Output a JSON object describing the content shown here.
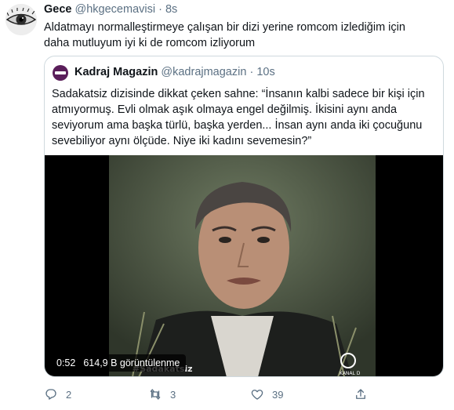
{
  "tweet": {
    "author_name": "Gece",
    "author_handle": "@hkgecemavisi",
    "separator": "·",
    "time": "8s",
    "text_line1": "Aldatmayı normalleştirmeye çalışan bir dizi yerine romcom izlediğim için",
    "text_line2": "daha mutluyum iyi ki de romcom izliyorum"
  },
  "quote": {
    "author_name": "Kadraj Magazin",
    "author_handle": "@kadrajmagazin",
    "separator": "·",
    "time": "10s",
    "text_lines": [
      "Sadakatsiz dizisinde dikkat çeken sahne: “İnsanın kalbi sadece bir kişi için",
      "atmıyormuş. Evli olmak aşık olmaya engel değilmiş. İkisini aynı anda",
      "seviyorum ama başka türlü, başka yerden... İnsan aynı anda iki çocuğunu",
      "sevebiliyor aynı ölçüde. Niye iki kadını sevemesin?”"
    ],
    "video": {
      "duration": "0:52",
      "views": "614,9 B görüntülenme",
      "overlay_caption": "#Sadakatsiz",
      "channel_logo": "KANAL D"
    }
  },
  "actions": {
    "reply_count": "2",
    "retweet_count": "3",
    "like_count": "39"
  },
  "icons": {
    "reply": "reply-icon",
    "retweet": "retweet-icon",
    "like": "heart-icon",
    "share": "share-icon"
  },
  "colors": {
    "secondary_text": "#5b7083",
    "border": "#cfd9de",
    "quote_avatar": "#5a1e5a"
  }
}
